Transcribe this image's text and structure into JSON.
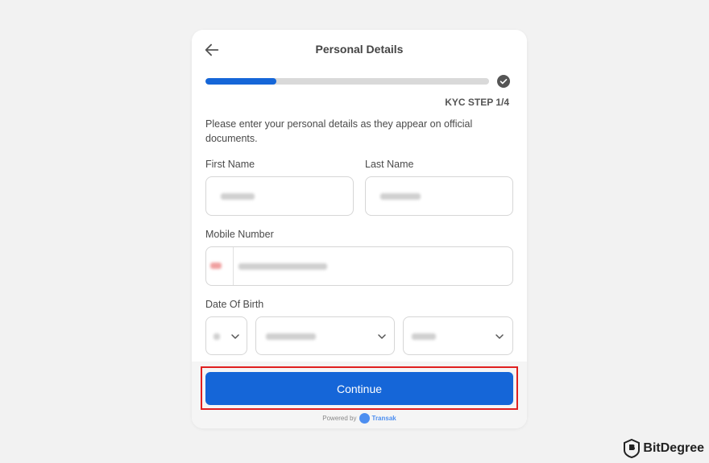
{
  "header": {
    "title": "Personal Details",
    "back_icon": "arrow-left-icon"
  },
  "progress": {
    "fraction": 0.25,
    "step_label": "KYC STEP 1/4",
    "check_icon": "check-circle-icon"
  },
  "form": {
    "instruction": "Please enter your personal details as they appear on official documents.",
    "first_name_label": "First Name",
    "last_name_label": "Last Name",
    "mobile_label": "Mobile Number",
    "dob_label": "Date Of Birth"
  },
  "actions": {
    "continue_label": "Continue",
    "primary_color": "#1566d8",
    "highlight_color": "#e02020"
  },
  "footer": {
    "powered_by": "Powered by",
    "brand": "Transak"
  },
  "watermark": {
    "text": "BitDegree"
  }
}
